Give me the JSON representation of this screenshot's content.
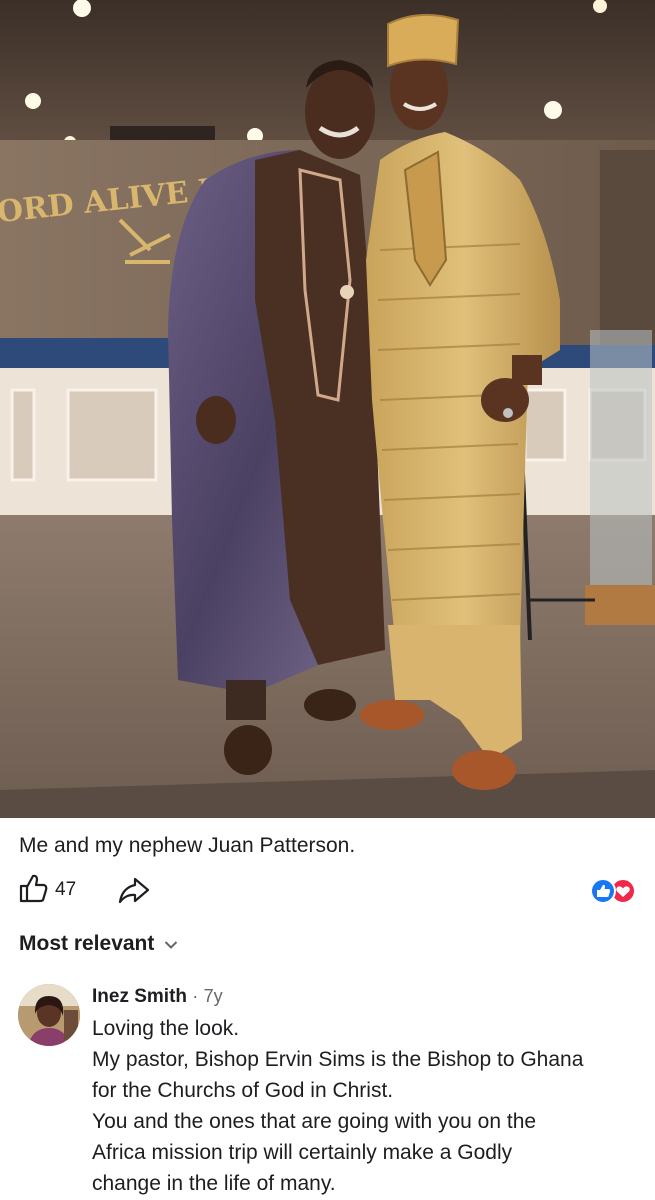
{
  "post": {
    "photo_sign_text": "ORD ALIVE M",
    "caption": "Me and my nephew Juan Patterson."
  },
  "actions": {
    "like_count": "47",
    "colors": {
      "like_blue": "#1877f2",
      "love_red": "#f02849",
      "icon_gray": "#1c1e21"
    }
  },
  "comments_sort": {
    "label": "Most relevant"
  },
  "comment": {
    "author": "Inez Smith",
    "separator": "·",
    "age": "7y",
    "lines": [
      "Loving the look.",
      "My pastor, Bishop Ervin Sims is the Bishop to Ghana",
      "for the Churchs of God in Christ.",
      "You and the ones that are going with you on the",
      "Africa mission trip will certainly make a Godly",
      "change in the life of many."
    ]
  }
}
